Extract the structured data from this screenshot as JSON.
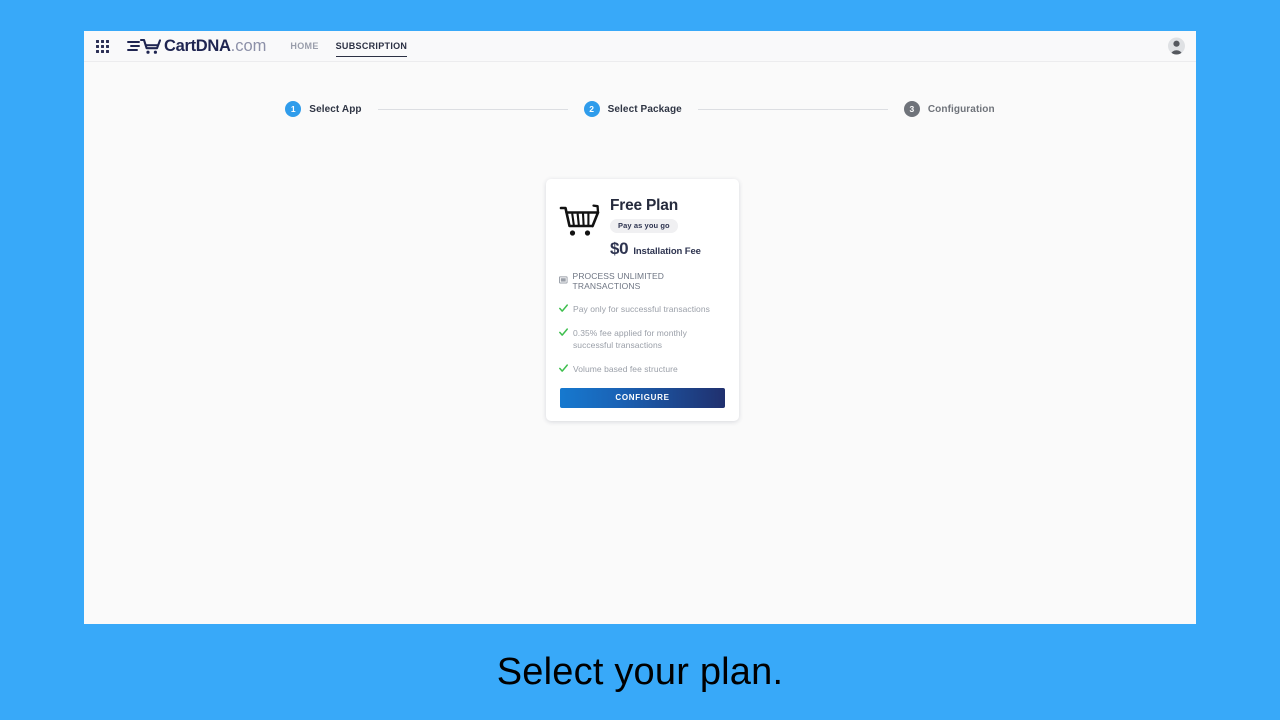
{
  "caption": "Select your plan.",
  "colors": {
    "page_background": "#38a9f9",
    "app_background": "#fafafa",
    "step_active": "#2f9ceb",
    "step_pending": "#6f737a",
    "check_green": "#3fbf4f",
    "button_gradient_start": "#1679cf",
    "button_gradient_end": "#20306e",
    "brand_navy": "#1f2551"
  },
  "topbar": {
    "apps_icon": "apps-grid-icon",
    "brand_name": "CartDNA",
    "brand_tld": ".com",
    "brand_icon": "shopping-cart-icon",
    "nav_links": [
      {
        "label": "HOME",
        "active": false
      },
      {
        "label": "SUBSCRIPTION",
        "active": true
      }
    ],
    "avatar_icon": "user-avatar-icon"
  },
  "stepper": {
    "steps": [
      {
        "number": "1",
        "label": "Select App",
        "state": "done"
      },
      {
        "number": "2",
        "label": "Select Package",
        "state": "done"
      },
      {
        "number": "3",
        "label": "Configuration",
        "state": "pending"
      }
    ]
  },
  "plan_card": {
    "icon": "shopping-cart-icon",
    "title": "Free Plan",
    "badge": "Pay as you go",
    "price": "$0",
    "price_label": "Installation Fee",
    "subhead_icon": "monitor-icon",
    "subhead": "PROCESS UNLIMITED TRANSACTIONS",
    "features": [
      "Pay only for successful transactions",
      "0.35% fee applied for monthly successful transactions",
      "Volume based fee structure"
    ],
    "cta_label": "CONFIGURE"
  }
}
